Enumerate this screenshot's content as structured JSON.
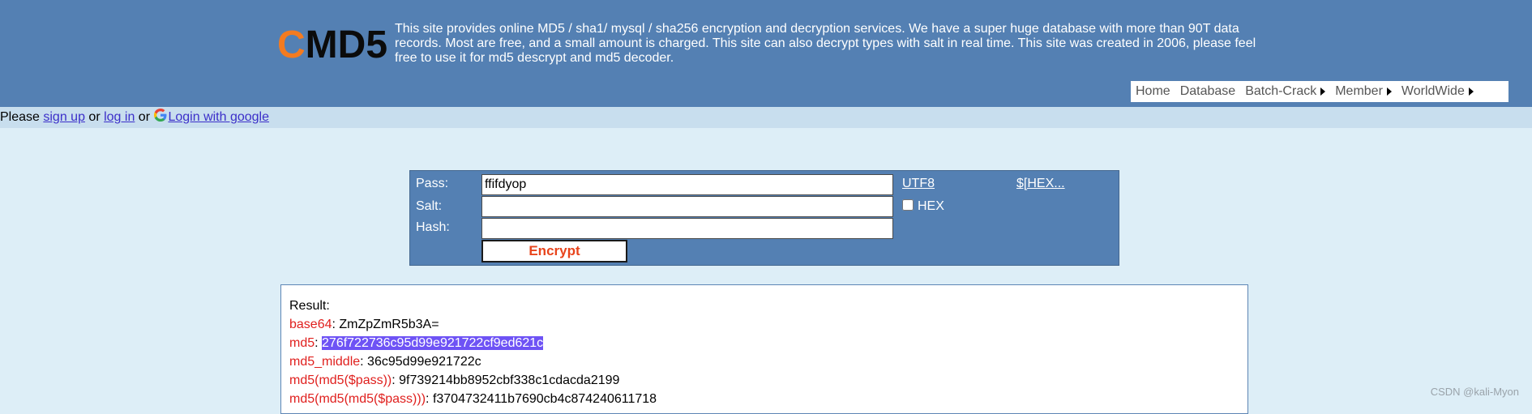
{
  "header": {
    "logo_first": "C",
    "logo_rest": "MD5",
    "tagline": "This site provides online MD5 / sha1/ mysql / sha256 encryption and decryption services. We have a super huge database with more than 90T data records. Most are free, and a small amount is charged. This site can also decrypt types with salt in real time. This site was created in 2006, please feel free to use it for md5 descrypt and md5 decoder.",
    "nav": [
      {
        "label": "Home",
        "has_arrow": false
      },
      {
        "label": "Database",
        "has_arrow": false
      },
      {
        "label": "Batch-Crack",
        "has_arrow": true
      },
      {
        "label": "Member",
        "has_arrow": true
      },
      {
        "label": "WorldWide",
        "has_arrow": true
      }
    ]
  },
  "loginbar": {
    "prefix": "Please ",
    "signup": "sign up",
    "or1": " or ",
    "login": "log in",
    "or2": " or ",
    "google": "Login with google"
  },
  "form": {
    "pass_label": "Pass:",
    "pass_value": "ffifdyop",
    "salt_label": "Salt:",
    "salt_value": "",
    "hash_label": "Hash:",
    "hash_value": "",
    "utf8_link": "UTF8",
    "hex_link": "$[HEX...",
    "hex_checkbox_label": "HEX",
    "hex_checked": false,
    "encrypt_label": "Encrypt"
  },
  "result": {
    "title": "Result:",
    "rows": [
      {
        "key": "base64",
        "value": "ZmZpZmR5b3A=",
        "selected": false
      },
      {
        "key": "md5",
        "value": "276f722736c95d99e921722cf9ed621c",
        "selected": true
      },
      {
        "key": "md5_middle",
        "value": "36c95d99e921722c",
        "selected": false
      },
      {
        "key": "md5(md5($pass))",
        "value": "9f739214bb8952cbf338c1cdacda2199",
        "selected": false
      },
      {
        "key": "md5(md5(md5($pass)))",
        "value": "f3704732411b7690cb4c874240611718",
        "selected": false
      }
    ]
  },
  "watermark": "CSDN @kali-Myon",
  "colors": {
    "header_bg": "#5480b3",
    "page_bg": "#ddeef7",
    "loginbar_bg": "#c8deee",
    "logo_accent": "#f47b20",
    "result_key": "#e0201e",
    "selection": "#6e53f5",
    "encrypt_text": "#e8441c"
  }
}
